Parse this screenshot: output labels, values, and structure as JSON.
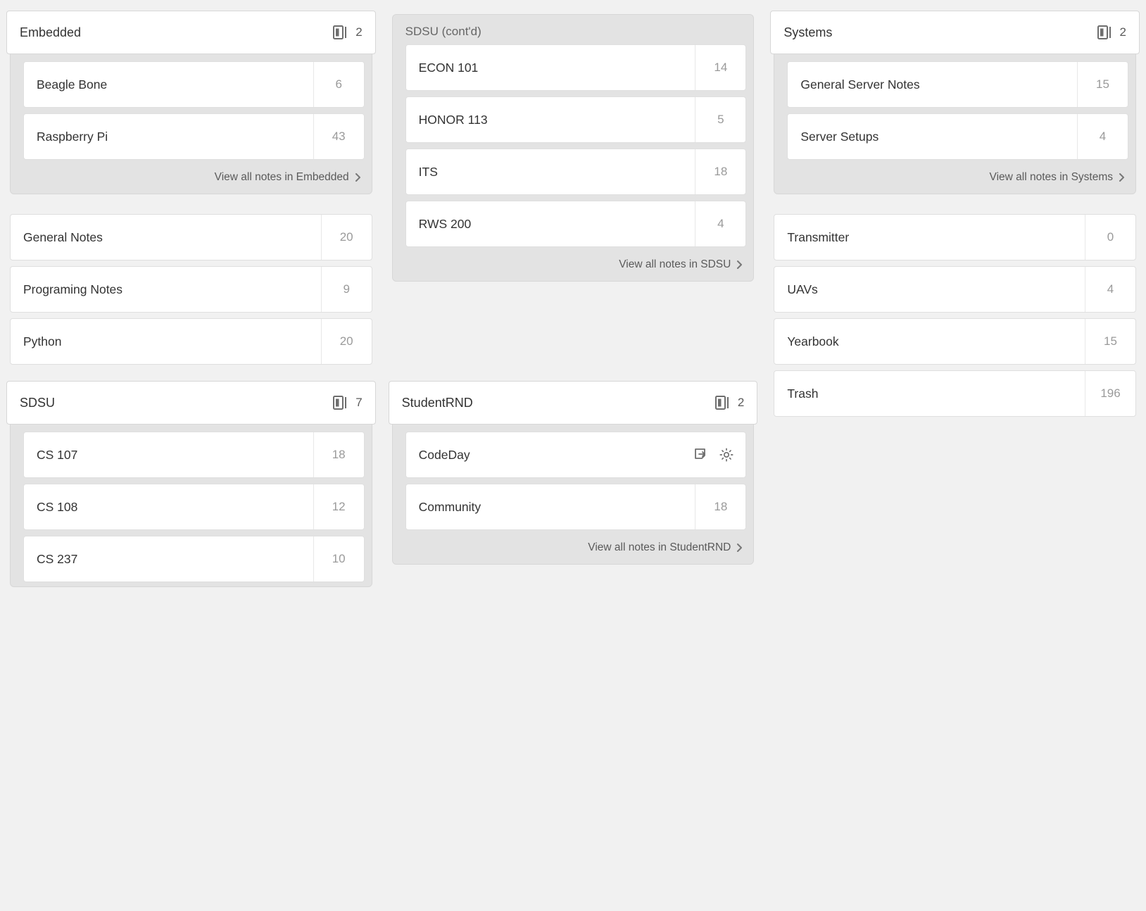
{
  "view_all_prefix": "View all notes in ",
  "columns": [
    {
      "blocks": [
        {
          "type": "stack",
          "title": "Embedded",
          "count": "2",
          "items": [
            {
              "name": "Beagle Bone",
              "count": "6"
            },
            {
              "name": "Raspberry Pi",
              "count": "43"
            }
          ],
          "footer_target": "Embedded"
        },
        {
          "type": "flat",
          "items": [
            {
              "name": "General Notes",
              "count": "20"
            },
            {
              "name": "Programing Notes",
              "count": "9"
            },
            {
              "name": "Python",
              "count": "20"
            }
          ]
        },
        {
          "type": "stack",
          "title": "SDSU",
          "count": "7",
          "items": [
            {
              "name": "CS 107",
              "count": "18"
            },
            {
              "name": "CS 108",
              "count": "12"
            },
            {
              "name": "CS 237",
              "count": "10"
            }
          ],
          "no_footer": true
        }
      ]
    },
    {
      "blocks": [
        {
          "type": "stack_continued",
          "title": "SDSU (cont'd)",
          "items": [
            {
              "name": "ECON 101",
              "count": "14"
            },
            {
              "name": "HONOR 113",
              "count": "5"
            },
            {
              "name": "ITS",
              "count": "18"
            },
            {
              "name": "RWS 200",
              "count": "4"
            }
          ],
          "footer_target": "SDSU"
        },
        {
          "type": "spacer"
        },
        {
          "type": "stack",
          "title": "StudentRND",
          "count": "2",
          "items": [
            {
              "name": "CodeDay",
              "actions": true
            },
            {
              "name": "Community",
              "count": "18"
            }
          ],
          "footer_target": "StudentRND"
        }
      ]
    },
    {
      "blocks": [
        {
          "type": "stack",
          "title": "Systems",
          "count": "2",
          "items": [
            {
              "name": "General Server Notes",
              "count": "15"
            },
            {
              "name": "Server Setups",
              "count": "4"
            }
          ],
          "footer_target": "Systems"
        },
        {
          "type": "flat",
          "items": [
            {
              "name": "Transmitter",
              "count": "0"
            },
            {
              "name": "UAVs",
              "count": "4"
            },
            {
              "name": "Yearbook",
              "count": "15"
            },
            {
              "name": "Trash",
              "count": "196"
            }
          ]
        }
      ]
    }
  ]
}
